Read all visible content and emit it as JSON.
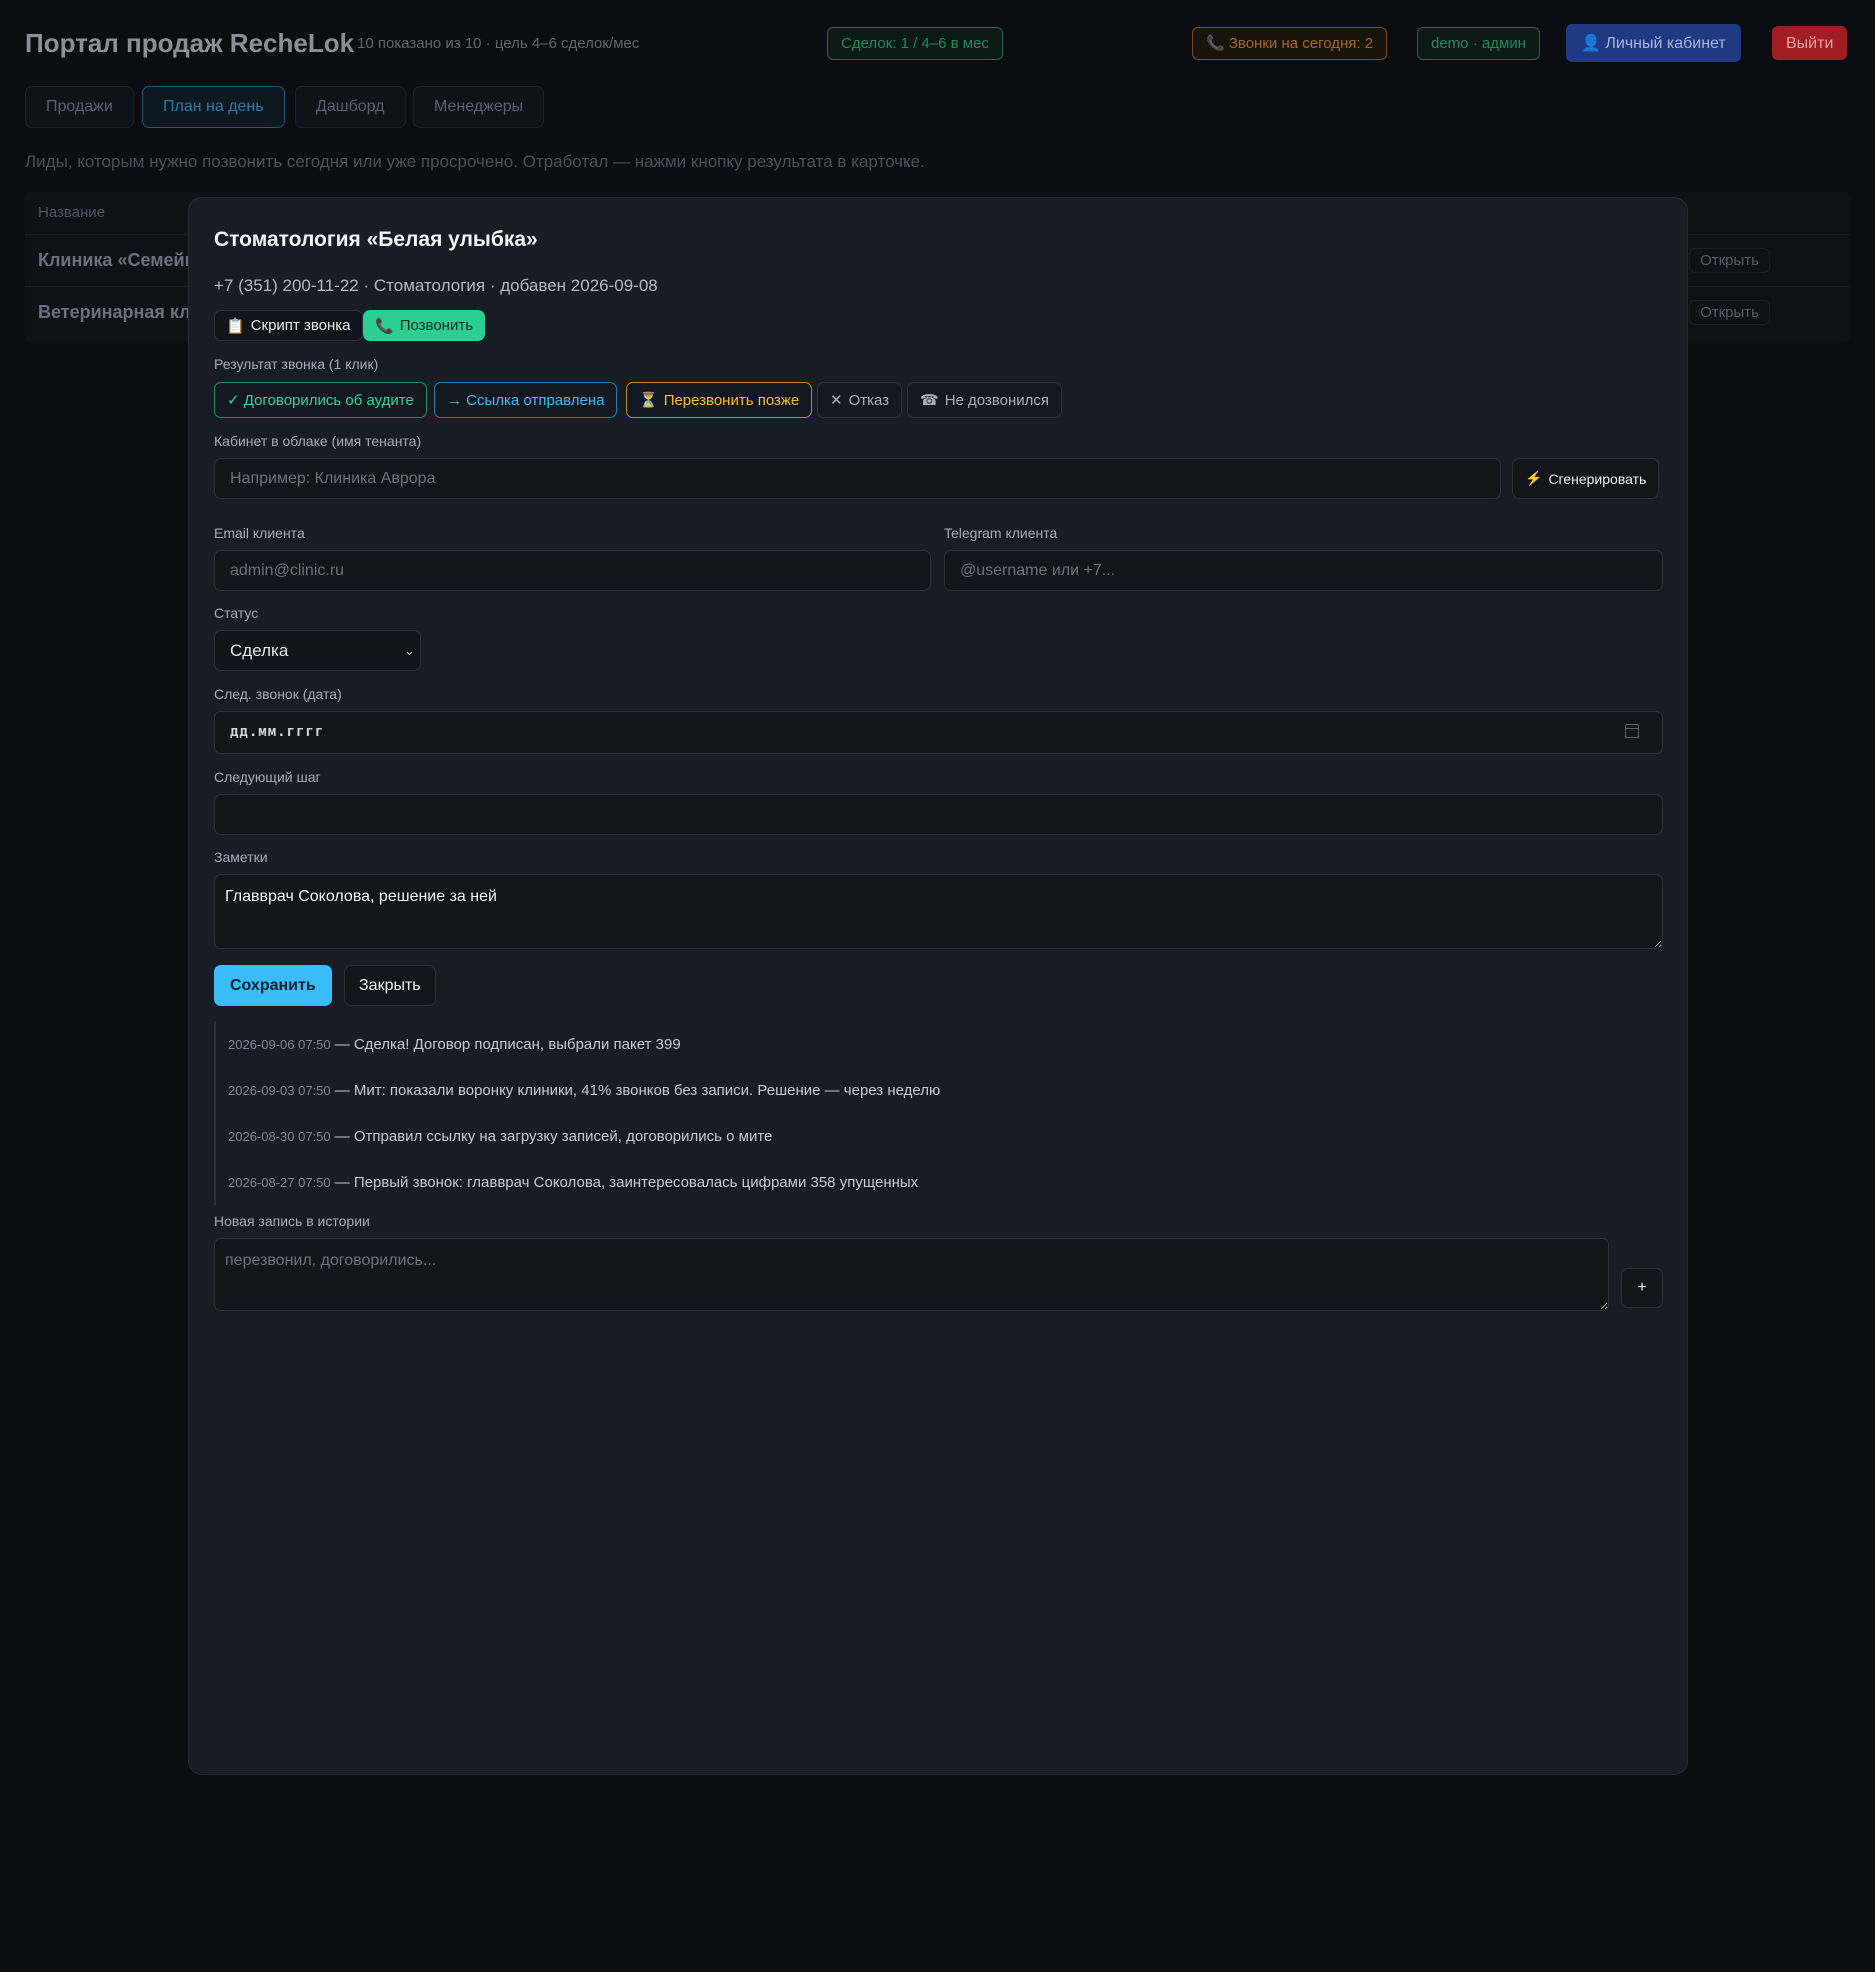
{
  "header": {
    "app_title": "Портал продаж RecheLok",
    "shown_info": "10 показано из 10 · цель 4–6 сделок/мес",
    "deals_badge": "Сделок: 1 / 4–6 в мес",
    "calls_badge": "Звонки на сегодня: 2",
    "user_badge": "demo · админ",
    "cabinet_button": "Личный кабинет",
    "logout_button": "Выйти"
  },
  "tabs": [
    {
      "label": "Продажи",
      "active": false
    },
    {
      "label": "План на день",
      "active": true
    },
    {
      "label": "Дашборд",
      "active": false
    },
    {
      "label": "Менеджеры",
      "active": false
    }
  ],
  "page_hint": "Лиды, которым нужно позвонить сегодня или уже просрочено. Отработал — нажми кнопку результата в карточке.",
  "table": {
    "header_name": "Название",
    "rows": [
      {
        "name": "Клиника «Семейн",
        "action": "Открыть"
      },
      {
        "name": "Ветеринарная кли",
        "action": "Открыть"
      }
    ]
  },
  "modal": {
    "title": "Стоматология «Белая улыбка»",
    "subtitle": "+7 (351) 200-11-22 · Стоматология · добавен 2026-09-08",
    "script_button": "Скрипт звонка",
    "call_button": "Позвонить",
    "result_label": "Результат звонка (1 клик)",
    "results": {
      "audit": "✓ Договорились об аудите",
      "link": "→ Ссылка отправлена",
      "later": "Перезвонить позже",
      "refuse": "Отказ",
      "no_answer": "Не дозвонился"
    },
    "tenant_label": "Кабинет в облаке (имя тенанта)",
    "tenant_placeholder": "Например: Клиника Аврора",
    "generate_button": "Сгенерировать",
    "email_label": "Email клиента",
    "email_placeholder": "admin@clinic.ru",
    "telegram_label": "Telegram клиента",
    "telegram_placeholder": "@username или +7...",
    "status_label": "Статус",
    "status_value": "Сделка",
    "next_call_label": "След. звонок (дата)",
    "next_call_value": "дд.мм.гггг",
    "next_step_label": "Следующий шаг",
    "next_step_value": "",
    "notes_label": "Заметки",
    "notes_value": "Главврач Соколова, решение за ней",
    "save_button": "Сохранить",
    "close_button": "Закрыть",
    "history": [
      {
        "time": "2026-09-06 07:50",
        "text": "— Сделка! Договор подписан, выбрали пакет 399"
      },
      {
        "time": "2026-09-03 07:50",
        "text": "— Мит: показали воронку клиники, 41% звонков без записи. Решение — через неделю"
      },
      {
        "time": "2026-08-30 07:50",
        "text": "— Отправил ссылку на загрузку записей, договорились о мите"
      },
      {
        "time": "2026-08-27 07:50",
        "text": "— Первый звонок: главврач Соколова, заинтересовалась цифрами 358 упущенных"
      }
    ],
    "new_entry_label": "Новая запись в истории",
    "new_entry_placeholder": "перезвонил, договорились...",
    "add_button": "+"
  },
  "colors": {
    "accent": "#38bdf8",
    "call_green": "#2ccf8f",
    "audit_green": "#34d399",
    "later_amber": "#fbbf24",
    "logout_red": "#a11d24"
  }
}
